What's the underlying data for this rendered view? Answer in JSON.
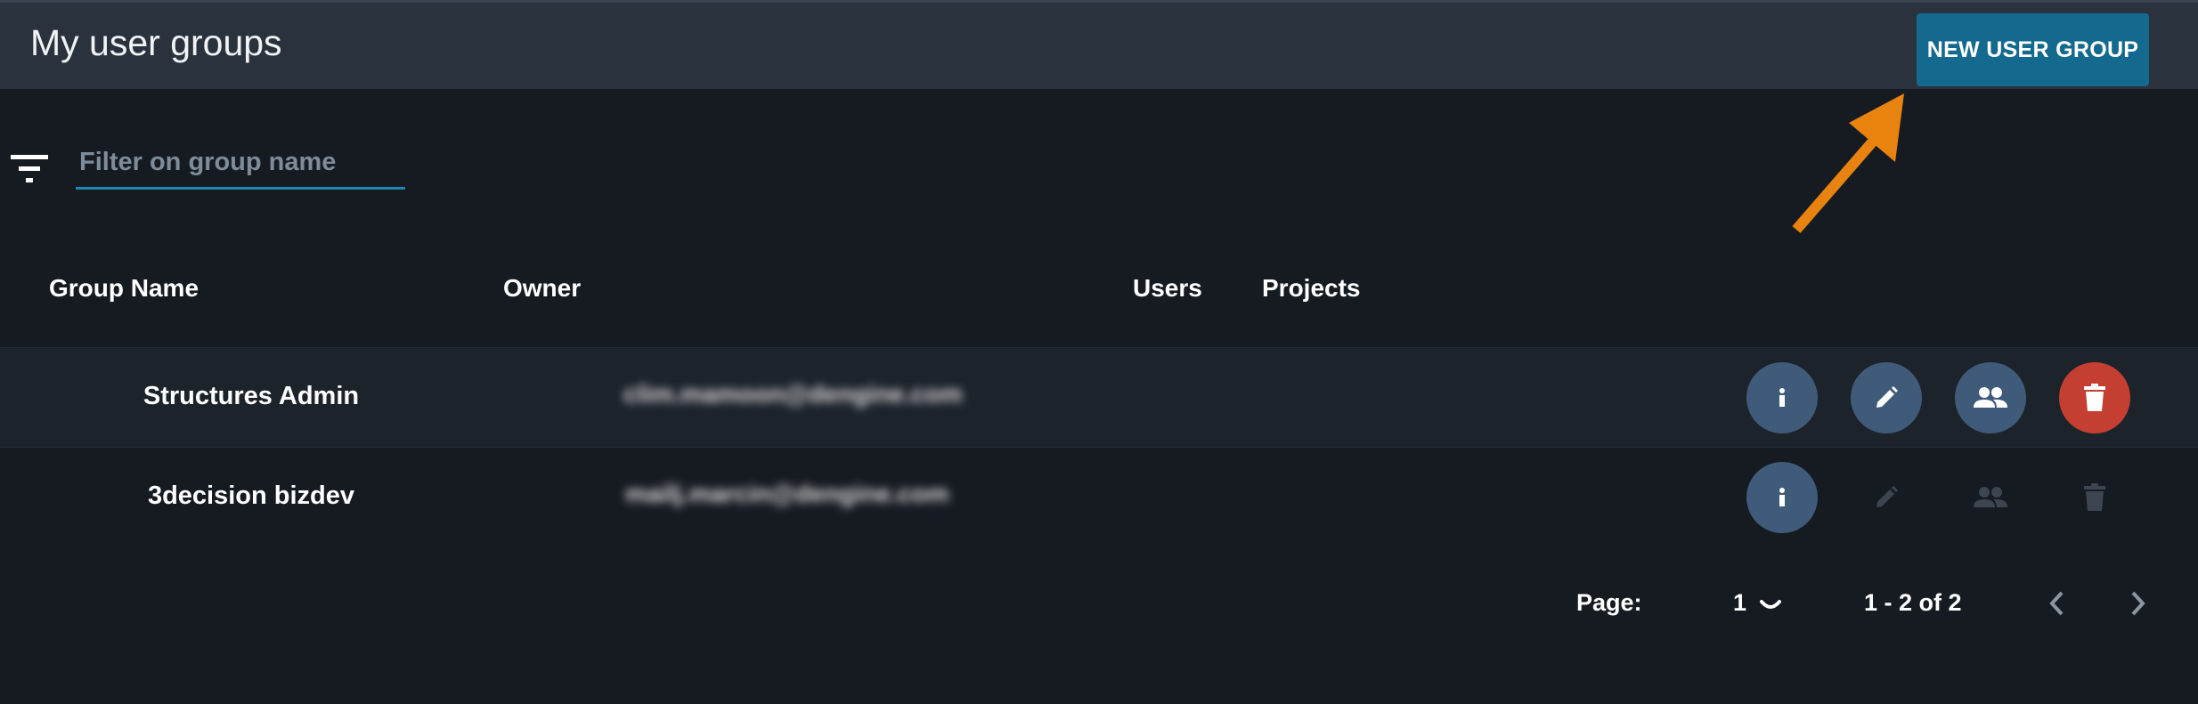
{
  "header": {
    "title": "My user groups",
    "new_group_label": "NEW USER GROUP"
  },
  "filter": {
    "placeholder": "Filter on group name",
    "value": ""
  },
  "table": {
    "columns": [
      "Group Name",
      "Owner",
      "Users",
      "Projects"
    ],
    "rows": [
      {
        "group_name": "Structures Admin",
        "owner": "clim.mamoon@dengine.com",
        "actions": [
          "info",
          "edit",
          "users",
          "delete"
        ],
        "editable": true
      },
      {
        "group_name": "3decision bizdev",
        "owner": "mailj.marcin@dengine.com",
        "actions": [
          "info"
        ],
        "editable": false
      }
    ]
  },
  "pager": {
    "label": "Page:",
    "page": "1",
    "range": "1 - 2 of 2"
  },
  "colors": {
    "accent": "#14698f",
    "arrow": "#e8830f",
    "action_active": "#3f5b79",
    "action_delete": "#c43f32",
    "action_disabled": "#3c4550"
  },
  "icons": {
    "filter": "filter-icon",
    "info": "info-icon",
    "edit": "pencil-icon",
    "users": "group-icon",
    "delete": "trash-icon",
    "prev": "chevron-left-icon",
    "next": "chevron-right-icon"
  }
}
